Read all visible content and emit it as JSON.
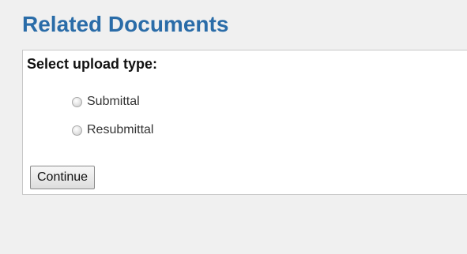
{
  "page": {
    "title": "Related Documents"
  },
  "form": {
    "heading": "Select upload type:",
    "options": [
      {
        "label": "Submittal",
        "selected": false
      },
      {
        "label": "Resubmittal",
        "selected": false
      }
    ],
    "continue_label": "Continue"
  },
  "colors": {
    "title": "#2a6ca8",
    "background": "#f0f0f0",
    "panel": "#ffffff",
    "panel_border": "#c8c8c8"
  }
}
